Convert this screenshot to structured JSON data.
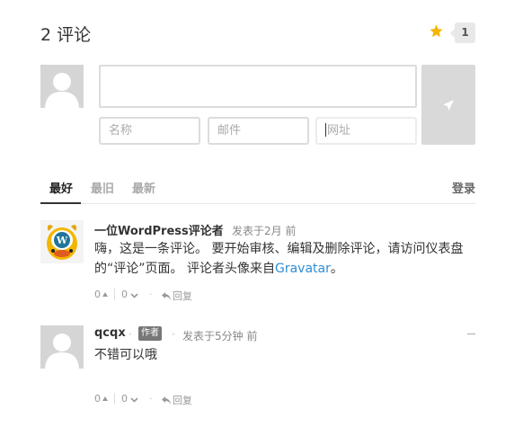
{
  "header": {
    "title": "2 评论",
    "count": "1"
  },
  "form": {
    "name_placeholder": "名称",
    "email_placeholder": "邮件",
    "url_placeholder": "网址"
  },
  "tabs": {
    "best": "最好",
    "oldest": "最旧",
    "newest": "最新",
    "login": "登录"
  },
  "comments": [
    {
      "author": "一位WordPress评论者",
      "sep": "·",
      "time": "发表于2月 前",
      "body_part1": "嗨，这是一条评论。 要开始审核、编辑及删除评论，请访问仪表盘的“评论”页面。 评论者头像来自",
      "link": "Gravatar",
      "body_part2": "。",
      "up": "0",
      "down": "0",
      "dot": "·",
      "reply": "回复"
    },
    {
      "author": "qcqx",
      "sep": "·",
      "badge": "作者",
      "sep2": "·",
      "time": "发表于5分钟 前",
      "body": "不错可以哦",
      "up": "0",
      "down": "0",
      "dot": "·",
      "reply": "回复"
    }
  ],
  "colors": {
    "accent": "#2e8ed6",
    "star": "#f4b400",
    "submit_bg": "#d9d9d9"
  }
}
